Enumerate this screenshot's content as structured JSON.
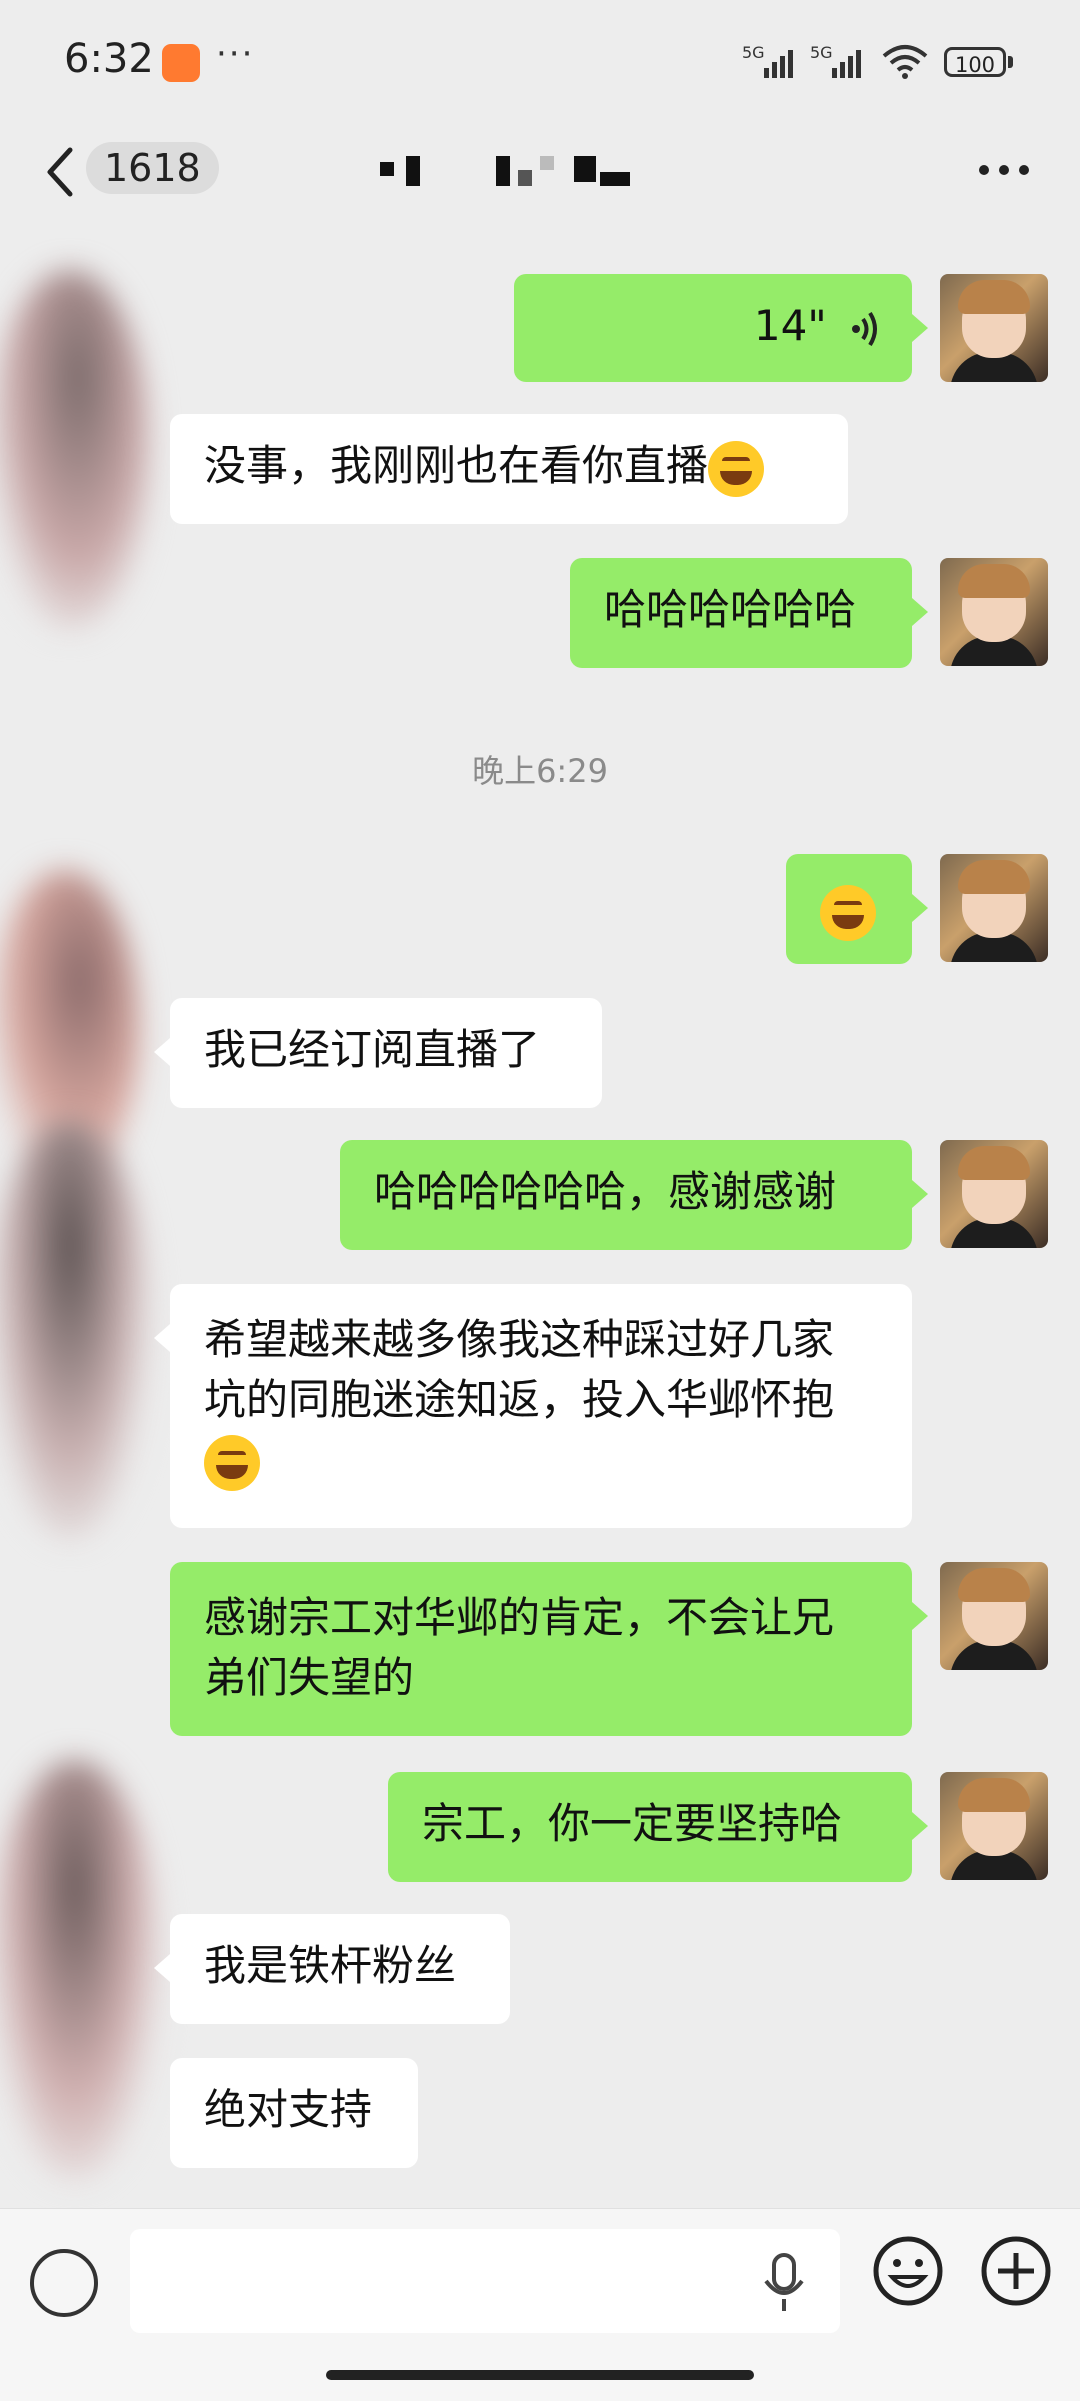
{
  "status_bar": {
    "time": "6:32",
    "overflow": "···",
    "network1": "5G",
    "network2": "5G",
    "battery": "100"
  },
  "nav": {
    "unread_count": "1618"
  },
  "messages": [
    {
      "side": "me",
      "type": "voice",
      "duration": "14\""
    },
    {
      "side": "them",
      "text": "没事，我刚刚也在看你直播",
      "emoji": "tears-of-joy"
    },
    {
      "side": "me",
      "text": "哈哈哈哈哈哈"
    },
    {
      "type": "time",
      "text": "晚上6:29"
    },
    {
      "side": "me",
      "type": "emoji",
      "emoji": "face-palm"
    },
    {
      "side": "them",
      "text": "我已经订阅直播了"
    },
    {
      "side": "me",
      "text": "哈哈哈哈哈哈，感谢感谢"
    },
    {
      "side": "them",
      "line1": "希望越来越多像我这种踩过好几家",
      "line2": "坑的同胞迷途知返，投入华邺怀抱",
      "emoji": "grin"
    },
    {
      "side": "me",
      "line1": "感谢宗工对华邺的肯定，不会让兄",
      "line2": "弟们失望的"
    },
    {
      "side": "me",
      "text": "宗工，你一定要坚持哈"
    },
    {
      "side": "them",
      "text": "我是铁杆粉丝"
    },
    {
      "side": "them",
      "text": "绝对支持"
    }
  ],
  "icons": {
    "back": "chevron-left-icon",
    "more": "more-icon",
    "mic": "mic-icon",
    "emoji": "emoji-icon",
    "plus": "plus-icon",
    "voice": "voice-icon"
  },
  "colors": {
    "my_bubble": "#95ec69",
    "their_bubble": "#ffffff",
    "background": "#ededed"
  }
}
